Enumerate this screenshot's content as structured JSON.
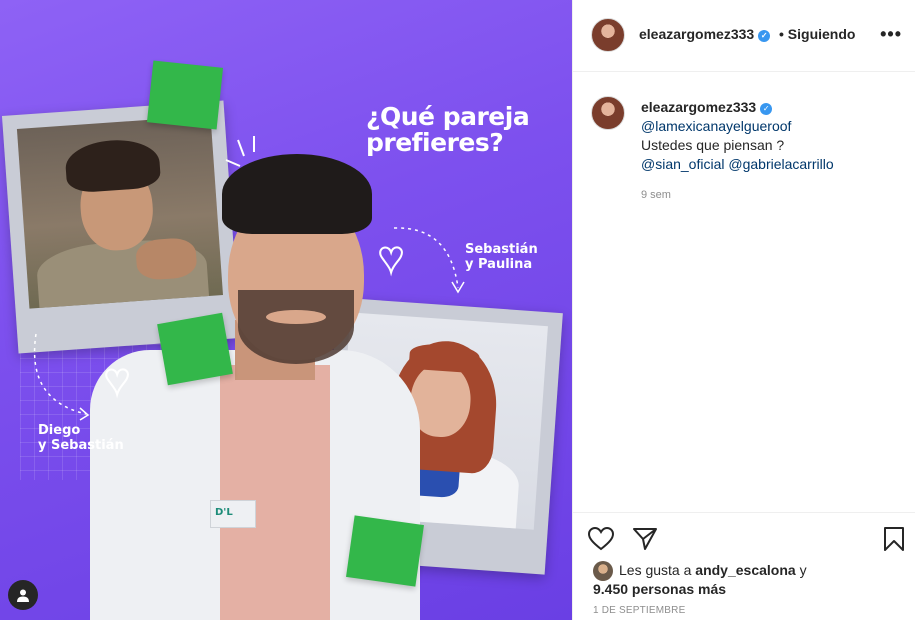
{
  "post": {
    "headline": "¿Qué pareja prefieres?",
    "couple_a": "Sebastián\ny Paulina",
    "couple_b": "Diego\ny Sebastián",
    "coat_logo": "D'L"
  },
  "header": {
    "username": "eleazargomez333",
    "verified_mark": "✓",
    "separator": "•",
    "follow_status": "Siguiendo",
    "more_label": "•••"
  },
  "caption": {
    "username": "eleazargomez333",
    "mention_1": "@lamexicanayelgueroof",
    "text": "Ustedes que piensan ?",
    "mention_2": "@sian_oficial",
    "mention_3": "@gabrielacarrillo",
    "age": "9 sem"
  },
  "likes": {
    "prefix": "Les gusta a",
    "user": "andy_escalona",
    "joiner": "y",
    "others": "9.450 personas más"
  },
  "post_date": "1 DE SEPTIEMBRE",
  "colors": {
    "background_purple": "#7d50ee",
    "accent_green": "#33b74a",
    "link_blue": "#00376b",
    "verified_blue": "#3897f0"
  }
}
